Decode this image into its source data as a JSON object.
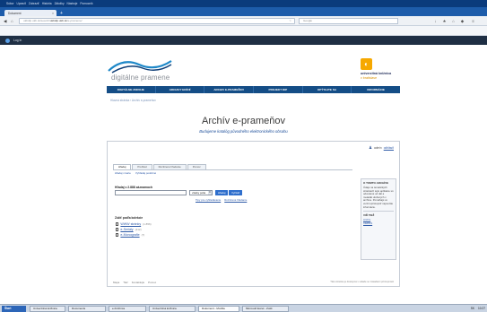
{
  "browser": {
    "menu": [
      "Súbor",
      "Upraviť",
      "Zobraziť",
      "História",
      "Záložky",
      "Nástroje",
      "Pomocník"
    ],
    "tab_title": "Dokument",
    "url_prefix": "ukbdip.ukb.sk/search/",
    "url_host": "ukbdip.ukb.sk",
    "url_path": "/e-pramene/",
    "search_placeholder": "Google"
  },
  "status_bar": {
    "label": "Log in"
  },
  "site": {
    "logo_text": "digitálne pramene",
    "ukb_line1": "univerzitná knižnica",
    "ukb_line2": "v bratislave",
    "nav": [
      "DIGITÁLNE ZDROJE",
      "ARCHIVY EDÍCIÍ",
      "ARCHIV E-PRAMEŇOV",
      "PROJEKT DIP",
      "OPÝTAJTE SA",
      "INFORMÁCIE"
    ],
    "breadcrumb": "Hlavná stránka › Archív e-prameňov",
    "title": "Archív e-prameňov",
    "subtitle": "Budujeme katalóg původného elektronického obsahu"
  },
  "frame": {
    "login_user": "admin",
    "login_link": "odhlásiť",
    "tabs": [
      "Hľadaj",
      "Prehľad",
      "Rozšírené hľadanie",
      "Pomoc"
    ],
    "subtabs": [
      "Hľadaj v karte",
      "Vyhľadaj podobné"
    ],
    "found_label": "Hľadaj v 2.888 záznamoch",
    "search_value": "",
    "select_value": "všetky polia",
    "btn_search": "Hľadaj",
    "btn_clear": "Vyčistiť",
    "links": [
      "Tipy pre vyhľadávanie",
      "Rozšírené hľadanie"
    ],
    "facet_title": "Zúžiť podľa kolekcie",
    "facets": [
      {
        "label": "WWW stránky",
        "count": "(1.856)"
      },
      {
        "label": "e-Seriály",
        "count": "(412)"
      },
      {
        "label": "e-Monografie",
        "count": "(7)"
      }
    ],
    "side_title": "O TOMTO ARCHÍVE",
    "side_body": "Údaje na tematických stránkach tejto aplikácie sú odvodené od dát a metadát uložených v archíve. Pomáhajú vo verzii sprístupniť najnovšie informácie.",
    "side_title2": "VIĎ TIEŽ",
    "side_links": [
      "Archív",
      "CERNS"
    ],
    "footer_links": [
      "Mapa",
      "Tlač",
      "Kontaktujte",
      "Pomoc"
    ],
    "footer_right": "Táto stránka je dostupná v súlade so zásadami prístupnosti"
  },
  "taskbar": {
    "start": "Štart",
    "items": [
      "Univerzitná knižnica",
      "Documents",
      "e-Knižnica",
      "Univerzitná knižnica",
      "Dokument - Mozilla",
      "Microsoft Excel - Zošit"
    ],
    "tray": [
      "SK",
      "10:27"
    ]
  },
  "colors": {
    "nav_bg": "#144d86",
    "brand_orange": "#f6a800",
    "link": "#2e5aa7",
    "button": "#2f6fcd"
  }
}
